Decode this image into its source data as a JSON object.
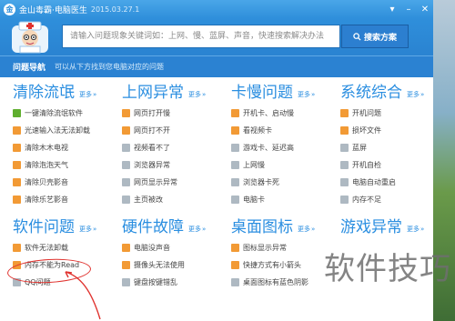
{
  "window": {
    "app_name": "金山毒霸·电脑医生",
    "version": "2015.03.27.1",
    "controls": [
      "pin-icon",
      "minimize-icon",
      "close-icon"
    ]
  },
  "search": {
    "placeholder": "请输入问题现象关键词如：上网、慢、蓝屏、声音，快速搜索解决办法",
    "button_label": "搜索方案"
  },
  "nav": {
    "title": "问题导航",
    "desc": "可以从下方找到您电脑对应的问题"
  },
  "sections": [
    {
      "title": "清除流氓",
      "more": "更多",
      "items": [
        {
          "label": "一键清除流氓软件",
          "icon": "green"
        },
        {
          "label": "光速输入法无法卸载",
          "icon": "orange"
        },
        {
          "label": "清除木木电视",
          "icon": "orange"
        },
        {
          "label": "清除泡泡天气",
          "icon": "orange"
        },
        {
          "label": "清除贝壳影音",
          "icon": "orange"
        },
        {
          "label": "清除乐艺影音",
          "icon": "orange"
        }
      ]
    },
    {
      "title": "上网异常",
      "more": "更多",
      "items": [
        {
          "label": "网页打开慢",
          "icon": "orange"
        },
        {
          "label": "网页打不开",
          "icon": "orange"
        },
        {
          "label": "视频看不了",
          "icon": "gray"
        },
        {
          "label": "浏览器异常",
          "icon": "gray"
        },
        {
          "label": "网页显示异常",
          "icon": "gray"
        },
        {
          "label": "主页被改",
          "icon": "gray"
        }
      ]
    },
    {
      "title": "卡慢问题",
      "more": "更多",
      "items": [
        {
          "label": "开机卡、启动慢",
          "icon": "orange"
        },
        {
          "label": "看视频卡",
          "icon": "orange"
        },
        {
          "label": "游戏卡、延迟高",
          "icon": "gray"
        },
        {
          "label": "上网慢",
          "icon": "gray"
        },
        {
          "label": "浏览器卡死",
          "icon": "gray"
        },
        {
          "label": "电脑卡",
          "icon": "gray"
        }
      ]
    },
    {
      "title": "系统综合",
      "more": "更多",
      "items": [
        {
          "label": "开机问题",
          "icon": "orange"
        },
        {
          "label": "损坏文件",
          "icon": "orange"
        },
        {
          "label": "蓝屏",
          "icon": "gray"
        },
        {
          "label": "开机自检",
          "icon": "gray"
        },
        {
          "label": "电脑自动重启",
          "icon": "gray"
        },
        {
          "label": "内存不足",
          "icon": "gray"
        }
      ]
    },
    {
      "title": "软件问题",
      "more": "更多",
      "items": [
        {
          "label": "软件无法卸载",
          "icon": "orange"
        },
        {
          "label": "内存不能为Read",
          "icon": "orange"
        },
        {
          "label": "QQ问题",
          "icon": "gray"
        }
      ]
    },
    {
      "title": "硬件故障",
      "more": "更多",
      "items": [
        {
          "label": "电脑没声音",
          "icon": "orange"
        },
        {
          "label": "摄像头无法使用",
          "icon": "orange"
        },
        {
          "label": "键盘按键错乱",
          "icon": "gray"
        }
      ]
    },
    {
      "title": "桌面图标",
      "more": "更多",
      "items": [
        {
          "label": "图标显示异常",
          "icon": "orange"
        },
        {
          "label": "快捷方式有小箭头",
          "icon": "orange"
        },
        {
          "label": "桌面图标有蓝色阴影",
          "icon": "gray"
        }
      ]
    },
    {
      "title": "游戏异常",
      "more": "更多",
      "items": []
    }
  ],
  "watermark": "软件技巧",
  "colors": {
    "brand_blue": "#2f8fdb",
    "section_title": "#2a8ee0",
    "highlight_red": "#e0322e"
  }
}
